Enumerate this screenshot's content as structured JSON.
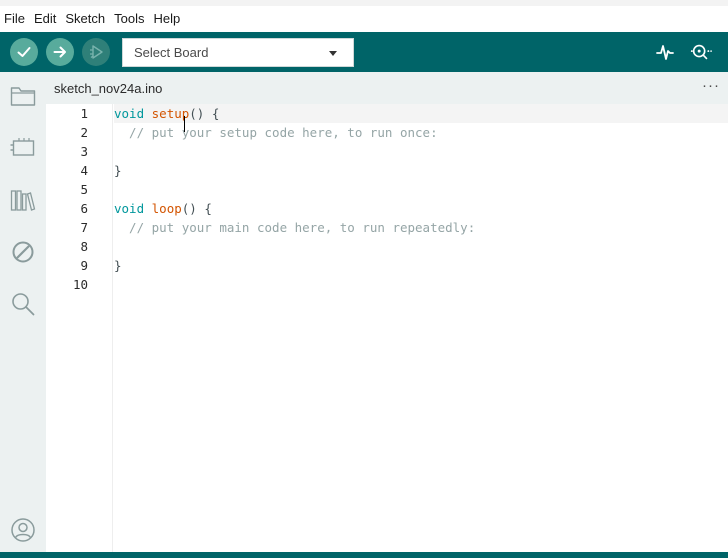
{
  "menubar": {
    "items": [
      {
        "label": "File"
      },
      {
        "label": "Edit"
      },
      {
        "label": "Sketch"
      },
      {
        "label": "Tools"
      },
      {
        "label": "Help"
      }
    ]
  },
  "toolbar": {
    "verify_icon": "check-icon",
    "upload_icon": "arrow-right-icon",
    "debug_icon": "debug-icon",
    "board_select": {
      "value": "Select Board"
    },
    "serial_plotter_icon": "pulse-icon",
    "serial_monitor_icon": "magnifier-dots-icon"
  },
  "sidebar": {
    "icons": [
      "folder-icon",
      "board-icon",
      "library-icon",
      "debug-disabled-icon",
      "search-icon",
      "account-icon"
    ]
  },
  "tabs": [
    {
      "label": "sketch_nov24a.ino"
    }
  ],
  "tab_more": "···",
  "editor": {
    "line_numbers": [
      "1",
      "2",
      "3",
      "4",
      "5",
      "6",
      "7",
      "8",
      "9",
      "10"
    ],
    "lines": [
      {
        "kw": "void",
        "fn": "setup",
        "rest": "() {"
      },
      {
        "comment": "  // put your setup code here, to run once:"
      },
      {
        "text": ""
      },
      {
        "text": "}"
      },
      {
        "text": ""
      },
      {
        "kw": "void",
        "fn": "loop",
        "rest": "() {"
      },
      {
        "comment": "  // put your main code here, to run repeatedly:"
      },
      {
        "text": ""
      },
      {
        "text": "}"
      },
      {
        "text": ""
      }
    ]
  },
  "colors": {
    "toolbar_bg": "#006468",
    "button_bg": "#58ab9c",
    "keyword": "#00979c",
    "function": "#d35400",
    "comment": "#95a5a6"
  }
}
